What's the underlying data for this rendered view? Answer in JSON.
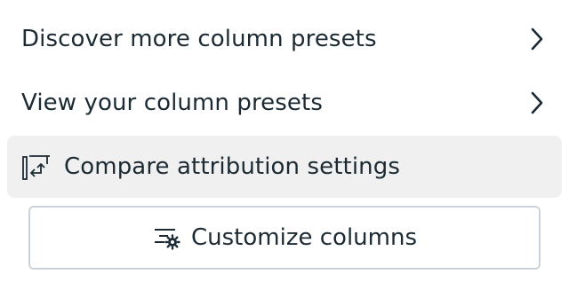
{
  "menu": {
    "items": [
      {
        "label": "Discover more column presets",
        "icon": "chevron-right-icon"
      },
      {
        "label": "View your column presets",
        "icon": "chevron-right-icon"
      },
      {
        "label": "Compare attribution settings",
        "icon": "compare-columns-icon",
        "highlighted": true
      }
    ],
    "customize_button": {
      "label": "Customize columns",
      "icon": "customize-columns-icon"
    }
  },
  "colors": {
    "text": "#1c2b33",
    "hover_background": "#f0f0f0",
    "button_border": "#cbd2d9"
  }
}
